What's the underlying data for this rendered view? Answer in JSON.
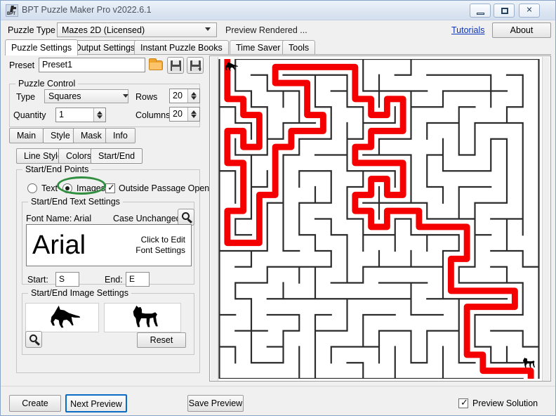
{
  "window": {
    "title": "BPT Puzzle Maker Pro v2022.6.1",
    "icon": "app-icon",
    "minimize": "–",
    "maximize": "□",
    "close": "✕"
  },
  "topbar": {
    "puzzle_type_label": "Puzzle Type",
    "puzzle_type_value": "Mazes 2D (Licensed)",
    "status": "Preview Rendered ...",
    "tutorials_link": "Tutorials",
    "about_button": "About"
  },
  "main_tabs": [
    {
      "label": "Puzzle Settings",
      "selected": true
    },
    {
      "label": "Output Settings",
      "selected": false
    },
    {
      "label": "Instant Puzzle Books",
      "selected": false
    },
    {
      "label": "Time Saver",
      "selected": false
    },
    {
      "label": "Tools",
      "selected": false
    }
  ],
  "preset": {
    "label": "Preset",
    "value": "Preset1",
    "placeholder": "",
    "open_icon": "folder-open-icon",
    "save_icon": "save-icon",
    "save_as_icon": "save-as-icon"
  },
  "puzzle_control": {
    "caption": "Puzzle Control",
    "type_label": "Type",
    "type_value": "Squares",
    "quantity_label": "Quantity",
    "quantity_value": "1",
    "rows_label": "Rows",
    "rows_value": "20",
    "columns_label": "Columns",
    "columns_value": "20"
  },
  "sub_tabs": [
    {
      "label": "Main",
      "selected": false
    },
    {
      "label": "Style",
      "selected": true
    },
    {
      "label": "Mask",
      "selected": false
    },
    {
      "label": "Info",
      "selected": false
    }
  ],
  "style_tabs": [
    {
      "label": "Line Style",
      "selected": false
    },
    {
      "label": "Colors",
      "selected": false
    },
    {
      "label": "Start/End",
      "selected": true
    }
  ],
  "start_end_points": {
    "caption": "Start/End Points",
    "text_radio": "Text",
    "images_radio": "Images",
    "selected_radio": "Images",
    "outside_passage_label": "Outside Passage Open",
    "outside_passage_checked": true,
    "highlight_color": "#2f8f3e"
  },
  "start_end_text": {
    "caption": "Start/End Text Settings",
    "font_name_label": "Font Name: Arial",
    "case_label": "Case Unchanged",
    "browse_icon": "magnifier-icon",
    "font_preview": "Arial",
    "edit_hint_line1": "Click to Edit",
    "edit_hint_line2": "Font Settings",
    "start_label": "Start:",
    "start_value": "S",
    "end_label": "End:",
    "end_value": "E"
  },
  "start_end_image": {
    "caption": "Start/End Image Settings",
    "start_image": "dog-jumping-silhouette",
    "end_image": "dog-standing-silhouette",
    "browse_icon": "magnifier-icon",
    "reset_button": "Reset"
  },
  "preview": {
    "name": "maze-preview",
    "rows": 20,
    "columns": 20,
    "solution_color": "#f40000",
    "wall_color": "#2b2b2b",
    "start_marker": "dog-jumping-silhouette",
    "end_marker": "dog-standing-silhouette"
  },
  "bottom_bar": {
    "create_button": "Create",
    "next_preview_button": "Next Preview",
    "save_preview_button": "Save Preview",
    "preview_solution_label": "Preview Solution",
    "preview_solution_checked": true
  }
}
